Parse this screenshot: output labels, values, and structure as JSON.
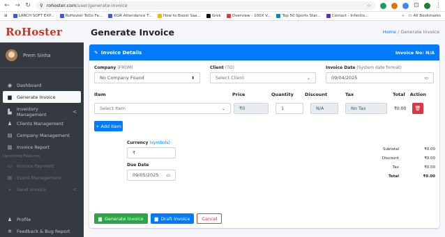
{
  "browser": {
    "url_host": "rohoster.com",
    "url_path": "/user/generate-invoice",
    "bookmarks": [
      "LARCH SOFT EXP...",
      "RoHoster ToDo Fe...",
      "KGR Attendance T...",
      "How to Boost Saa...",
      "Grok",
      "Overview - 100X V...",
      "Top 50 Sports Star...",
      "Contact - Infectio..."
    ],
    "all_bookmarks": "All Bookmarks",
    "more": "»"
  },
  "sidebar": {
    "logo": "RoHoster",
    "user": "Prem Sinha",
    "items": [
      {
        "icon": "dashboard-icon",
        "glyph": "◉",
        "label": "Dashboard"
      },
      {
        "icon": "file-invoice-icon",
        "glyph": "▆",
        "label": "Generate Invoice",
        "active": true
      },
      {
        "icon": "inventory-icon",
        "glyph": "▙",
        "label": "Inventory Management",
        "caret": "<"
      },
      {
        "icon": "clients-icon",
        "glyph": "♟",
        "label": "Clients Management"
      },
      {
        "icon": "company-icon",
        "glyph": "▤",
        "label": "Company Management"
      },
      {
        "icon": "report-icon",
        "glyph": "▥",
        "label": "Invoice Report"
      }
    ],
    "section": "Upcoming Features",
    "upcoming": [
      {
        "icon": "payment-icon",
        "glyph": "▭",
        "label": "Invoice Payment"
      },
      {
        "icon": "calendar-icon",
        "glyph": "▦",
        "label": "Event Management"
      },
      {
        "icon": "send-icon",
        "glyph": "➢",
        "label": "Send Invoice",
        "caret": "<"
      }
    ],
    "bottom": [
      {
        "icon": "profile-icon",
        "glyph": "♟",
        "label": "Profile"
      },
      {
        "icon": "bug-icon",
        "glyph": "✲",
        "label": "Feedback & Bug Report"
      }
    ]
  },
  "header": {
    "title": "Generate Invoice",
    "breadcrumb_home": "Home",
    "breadcrumb_sep": "/",
    "breadcrumb_current": "Generate Invoice"
  },
  "card": {
    "title": "Invoice Details",
    "invoice_no": "Invoice No: N/A",
    "company_label": "Company",
    "company_sub": "(FROM)",
    "company_value": "No Company Found",
    "client_label": "Client",
    "client_sub": "(TO)",
    "client_placeholder": "Select Client",
    "date_label": "Invoice Date",
    "date_sub": "(System date format)",
    "date_value": "09/04/2025",
    "columns": [
      "Item",
      "Price",
      "Quantity",
      "Discount",
      "Tax",
      "Total",
      "Action"
    ],
    "item_placeholder": "Select Item",
    "price": "₹0",
    "quantity": "1",
    "discount": "N/A",
    "tax": "No Tax",
    "line_total": "₹0.00",
    "add_item": "+ Add Item",
    "currency_label": "Currency",
    "currency_sub": "(symbols)",
    "currency_value": "₹",
    "due_label": "Due Date",
    "due_value": "09/05/2025",
    "totals": [
      {
        "k": "Subtotal",
        "v": "₹0.00"
      },
      {
        "k": "Discount",
        "v": "₹0.00"
      },
      {
        "k": "Tax",
        "v": "₹0.00"
      },
      {
        "k": "Total",
        "v": "₹0.00",
        "bold": true
      }
    ],
    "btn_generate": "Generate Invoice",
    "btn_draft": "Draft Invoice",
    "btn_cancel": "Cancel"
  },
  "colors": {
    "primary": "#007bff",
    "sidebar": "#343a40",
    "success": "#28a745",
    "danger": "#dc3545",
    "brand": "#c0392b"
  }
}
